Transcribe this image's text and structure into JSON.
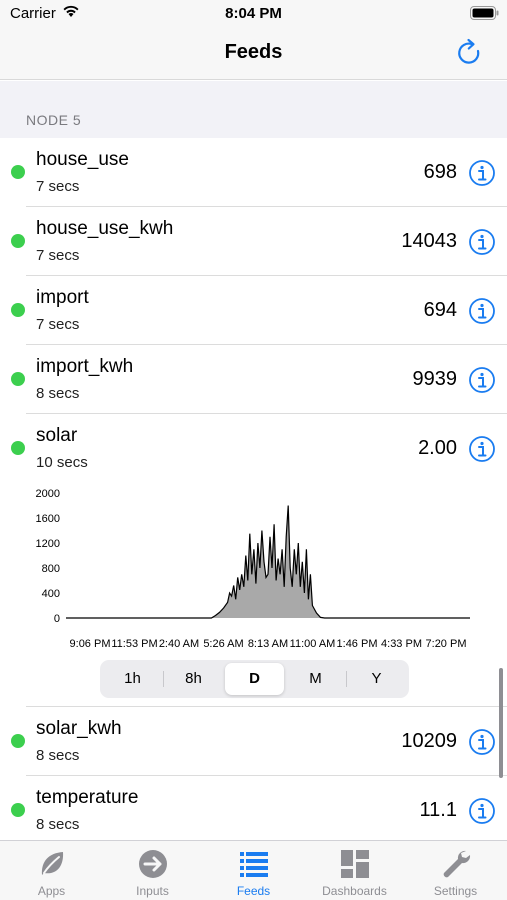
{
  "status_bar": {
    "carrier": "Carrier",
    "time": "8:04 PM"
  },
  "nav": {
    "title": "Feeds"
  },
  "section": {
    "title": "NODE 5"
  },
  "feeds_top": [
    {
      "name": "house_use",
      "age": "7 secs",
      "value": "698"
    },
    {
      "name": "house_use_kwh",
      "age": "7 secs",
      "value": "14043"
    },
    {
      "name": "import",
      "age": "7 secs",
      "value": "694"
    },
    {
      "name": "import_kwh",
      "age": "8 secs",
      "value": "9939"
    },
    {
      "name": "solar",
      "age": "10 secs",
      "value": "2.00"
    }
  ],
  "feeds_bottom": [
    {
      "name": "solar_kwh",
      "age": "8 secs",
      "value": "10209"
    },
    {
      "name": "temperature",
      "age": "8 secs",
      "value": "11.1"
    }
  ],
  "range_selector": {
    "options": [
      "1h",
      "8h",
      "D",
      "M",
      "Y"
    ],
    "selected": "D"
  },
  "tabs": [
    {
      "label": "Apps",
      "icon": "leaf-icon"
    },
    {
      "label": "Inputs",
      "icon": "arrow-circle-icon"
    },
    {
      "label": "Feeds",
      "icon": "list-icon"
    },
    {
      "label": "Dashboards",
      "icon": "grid-icon"
    },
    {
      "label": "Settings",
      "icon": "wrench-icon"
    }
  ],
  "active_tab": "Feeds",
  "colors": {
    "accent": "#1a7cf0",
    "online": "#3ccf4e",
    "chart_fill": "#a9a9a9"
  },
  "chart_data": {
    "type": "area",
    "title": "",
    "xlabel": "",
    "ylabel": "",
    "ylim": [
      0,
      2000
    ],
    "yticks": [
      "2000",
      "1600",
      "1200",
      "800",
      "400",
      "0"
    ],
    "xticks": [
      "9:06 PM",
      "11:53 PM",
      "2:40 AM",
      "5:26 AM",
      "8:13 AM",
      "11:00 AM",
      "1:46 PM",
      "4:33 PM",
      "7:20 PM"
    ],
    "series": [
      {
        "values": [
          [
            0,
            0
          ],
          [
            0.36,
            0
          ],
          [
            0.37,
            40
          ],
          [
            0.38,
            90
          ],
          [
            0.39,
            160
          ],
          [
            0.4,
            250
          ],
          [
            0.405,
            400
          ],
          [
            0.41,
            350
          ],
          [
            0.415,
            520
          ],
          [
            0.42,
            300
          ],
          [
            0.425,
            650
          ],
          [
            0.43,
            450
          ],
          [
            0.435,
            700
          ],
          [
            0.44,
            500
          ],
          [
            0.445,
            1000
          ],
          [
            0.45,
            600
          ],
          [
            0.455,
            1350
          ],
          [
            0.46,
            700
          ],
          [
            0.465,
            1100
          ],
          [
            0.47,
            550
          ],
          [
            0.475,
            1200
          ],
          [
            0.48,
            800
          ],
          [
            0.485,
            1400
          ],
          [
            0.49,
            900
          ],
          [
            0.495,
            650
          ],
          [
            0.5,
            700
          ],
          [
            0.505,
            1300
          ],
          [
            0.51,
            800
          ],
          [
            0.515,
            1500
          ],
          [
            0.52,
            600
          ],
          [
            0.525,
            950
          ],
          [
            0.53,
            700
          ],
          [
            0.535,
            1100
          ],
          [
            0.54,
            500
          ],
          [
            0.545,
            1300
          ],
          [
            0.55,
            1800
          ],
          [
            0.555,
            800
          ],
          [
            0.56,
            500
          ],
          [
            0.565,
            1100
          ],
          [
            0.57,
            700
          ],
          [
            0.575,
            1200
          ],
          [
            0.58,
            500
          ],
          [
            0.585,
            900
          ],
          [
            0.59,
            400
          ],
          [
            0.595,
            1100
          ],
          [
            0.6,
            300
          ],
          [
            0.605,
            700
          ],
          [
            0.61,
            200
          ],
          [
            0.62,
            80
          ],
          [
            0.63,
            10
          ],
          [
            0.64,
            0
          ],
          [
            1.0,
            0
          ]
        ]
      }
    ]
  }
}
